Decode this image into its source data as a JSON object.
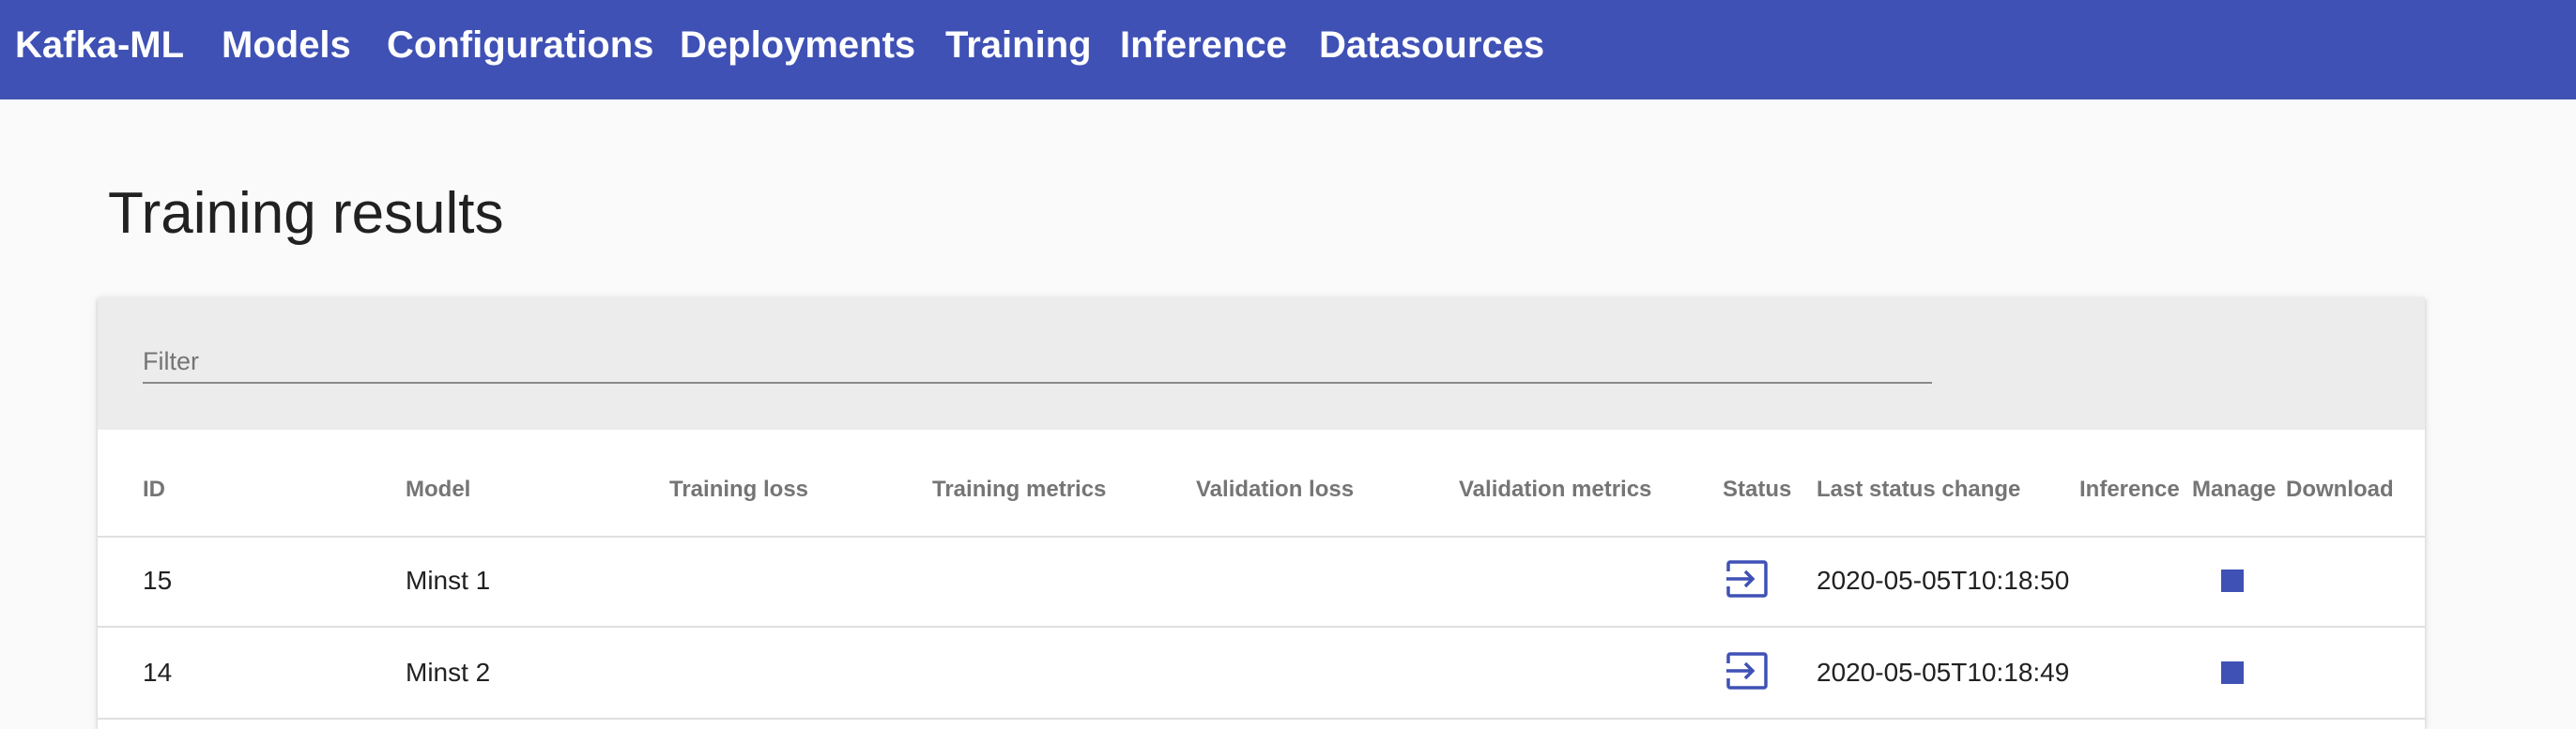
{
  "nav": {
    "brand": "Kafka-ML",
    "links": [
      "Models",
      "Configurations",
      "Deployments",
      "Training",
      "Inference",
      "Datasources"
    ]
  },
  "page": {
    "title": "Training results"
  },
  "filter": {
    "placeholder": "Filter",
    "value": ""
  },
  "table": {
    "columns": [
      "ID",
      "Model",
      "Training loss",
      "Training metrics",
      "Validation loss",
      "Validation metrics",
      "Status",
      "Last status change",
      "Inference",
      "Manage",
      "Download"
    ],
    "rows": [
      {
        "id": "15",
        "model": "Minst 1",
        "training_loss": "",
        "training_metrics": "",
        "validation_loss": "",
        "validation_metrics": "",
        "status_icon": "input-icon",
        "last_status_change": "2020-05-05T10:18:50.",
        "inference": "",
        "manage_icon": "stop-icon",
        "download": ""
      },
      {
        "id": "14",
        "model": "Minst 2",
        "training_loss": "",
        "training_metrics": "",
        "validation_loss": "",
        "validation_metrics": "",
        "status_icon": "input-icon",
        "last_status_change": "2020-05-05T10:18:49.",
        "inference": "",
        "manage_icon": "stop-icon",
        "download": ""
      }
    ]
  },
  "colors": {
    "primary": "#3f51b5",
    "background": "#fafafa",
    "filter_bg": "#ececec",
    "header_text": "#757575"
  }
}
